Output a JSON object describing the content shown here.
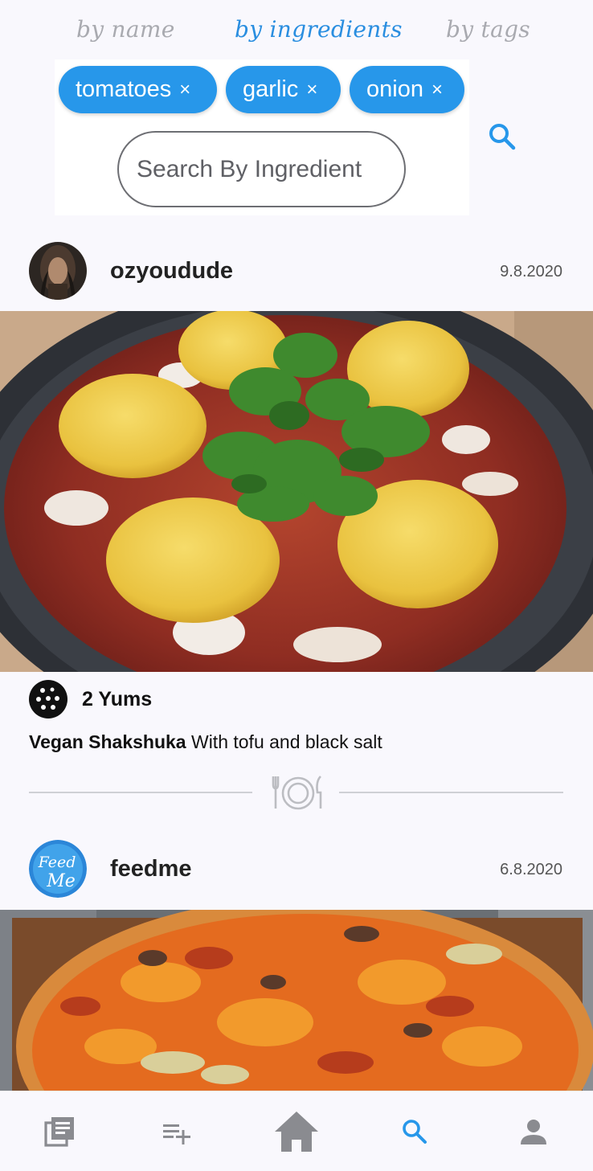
{
  "search_modes": {
    "by_name": "by name",
    "by_ingredients": "by ingredients",
    "by_tags": "by tags",
    "active": "by ingredients"
  },
  "search": {
    "chips": [
      {
        "label": "tomatoes",
        "remove": "×"
      },
      {
        "label": "garlic",
        "remove": "×"
      },
      {
        "label": "onion",
        "remove": "×"
      }
    ],
    "placeholder": "Search By Ingredient",
    "search_icon": "search-icon"
  },
  "posts": [
    {
      "username": "ozyoudude",
      "date": "9.8.2020",
      "avatar_icon": "user-avatar",
      "yums": "2 Yums",
      "recipe_title": "Vegan Shakshuka",
      "recipe_desc": " With tofu and black salt"
    },
    {
      "username": "feedme",
      "date": "6.8.2020",
      "avatar_text_1": "Feed",
      "avatar_text_2": "Me"
    }
  ],
  "nav": {
    "items": [
      "feed-icon",
      "add-recipe-icon",
      "home-icon",
      "search-icon",
      "profile-icon"
    ],
    "active": "search-icon"
  },
  "colors": {
    "accent": "#2797ea",
    "inactive_icon": "#8a8b90",
    "background": "#f9f8fd"
  }
}
